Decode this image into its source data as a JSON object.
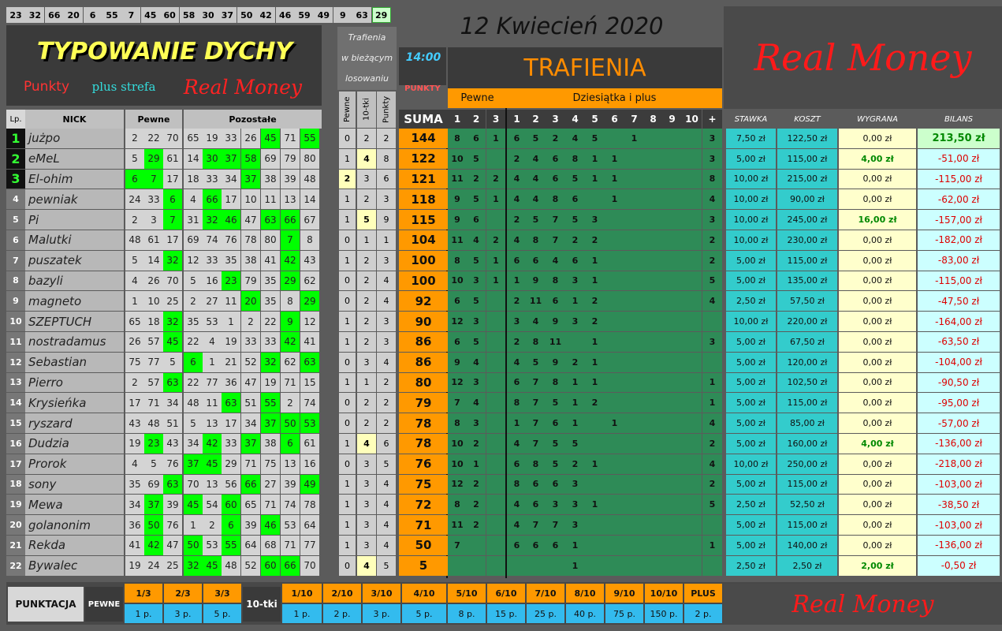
{
  "top_numbers": [
    "23",
    "32",
    "66",
    "20",
    "6",
    "55",
    "7",
    "45",
    "60",
    "58",
    "30",
    "37",
    "50",
    "42",
    "46",
    "59",
    "49",
    "9",
    "63",
    "29"
  ],
  "top_highlight_index": 19,
  "date_text": "12  Kwiecień  2020",
  "banner": {
    "title": "TYPOWANIE DYCHY",
    "sub1": "Punkty",
    "sub2": "plus strefa",
    "sub3": "Real Money"
  },
  "trafienia_box": {
    "line1": "Trafienia",
    "line2": "w bieżącym",
    "line3": "losowaniu"
  },
  "time": "14:00",
  "punkty_label": "PUNKTY",
  "trafienia_title": "TRAFIENIA",
  "pewne_label": "Pewne",
  "dziesiatka_label": "Dziesiątka i plus",
  "real_money_top": "Real Money",
  "real_money_bottom": "Real Money",
  "headers": {
    "lp": "Lp.",
    "nick": "NICK",
    "pewne": "Pewne",
    "pozostale": "Pozostałe",
    "v_pewne": "Pewne",
    "v_10tki": "10-tki",
    "v_punkty": "Punkty",
    "suma": "SUMA",
    "p_cols": [
      "1",
      "2",
      "3"
    ],
    "d_cols": [
      "1",
      "2",
      "3",
      "4",
      "5",
      "6",
      "7",
      "8",
      "9",
      "10",
      "+"
    ],
    "stawka": "STAWKA",
    "koszt": "KOSZT",
    "wygrana": "WYGRANA",
    "bilans": "BILANS"
  },
  "rows": [
    {
      "lp": "1",
      "nick": "jużpo",
      "nums": [
        "2",
        "22",
        "70",
        "65",
        "19",
        "33",
        "26",
        "45",
        "71",
        "55"
      ],
      "hits": [
        7,
        9
      ],
      "tr": [
        "0",
        "2",
        "2"
      ],
      "suma": "144",
      "p": [
        "8",
        "6",
        "1"
      ],
      "d": [
        "6",
        "5",
        "2",
        "4",
        "5",
        "",
        "1",
        "",
        "",
        "",
        ""
      ],
      "plus": "3",
      "stawka": "7,50 zł",
      "koszt": "122,50 zł",
      "wygrana": "0,00 zł",
      "bilans": "213,50 zł",
      "positive": true
    },
    {
      "lp": "2",
      "nick": "eMeL",
      "nums": [
        "5",
        "29",
        "61",
        "14",
        "30",
        "37",
        "58",
        "69",
        "79",
        "80"
      ],
      "hits": [
        1,
        4,
        5,
        6
      ],
      "tr": [
        "1",
        "4",
        "8"
      ],
      "suma": "122",
      "p": [
        "10",
        "5",
        ""
      ],
      "d": [
        "2",
        "4",
        "6",
        "8",
        "1",
        "1",
        "",
        "",
        "",
        "",
        ""
      ],
      "plus": "3",
      "stawka": "5,00 zł",
      "koszt": "115,00 zł",
      "wygrana": "4,00 zł",
      "bilans": "-51,00 zł"
    },
    {
      "lp": "3",
      "nick": "El-ohim",
      "nums": [
        "6",
        "7",
        "17",
        "18",
        "33",
        "34",
        "37",
        "38",
        "39",
        "48"
      ],
      "hits": [
        0,
        1,
        6
      ],
      "tr": [
        "2",
        "3",
        "6"
      ],
      "suma": "121",
      "p": [
        "11",
        "2",
        "2"
      ],
      "d": [
        "4",
        "4",
        "6",
        "5",
        "1",
        "1",
        "",
        "",
        "",
        "",
        ""
      ],
      "plus": "8",
      "stawka": "10,00 zł",
      "koszt": "215,00 zł",
      "wygrana": "0,00 zł",
      "bilans": "-115,00 zł"
    },
    {
      "lp": "4",
      "nick": "pewniak",
      "nums": [
        "24",
        "33",
        "6",
        "4",
        "66",
        "17",
        "10",
        "11",
        "13",
        "14"
      ],
      "hits": [
        2,
        4
      ],
      "tr": [
        "1",
        "2",
        "3"
      ],
      "suma": "118",
      "p": [
        "9",
        "5",
        "1"
      ],
      "d": [
        "4",
        "4",
        "8",
        "6",
        "",
        "1",
        "",
        "",
        "",
        "",
        ""
      ],
      "plus": "4",
      "stawka": "10,00 zł",
      "koszt": "90,00 zł",
      "wygrana": "0,00 zł",
      "bilans": "-62,00 zł"
    },
    {
      "lp": "5",
      "nick": "Pi",
      "nums": [
        "2",
        "3",
        "7",
        "31",
        "32",
        "46",
        "47",
        "63",
        "66",
        "67"
      ],
      "hits": [
        2,
        4,
        5,
        7,
        8
      ],
      "tr": [
        "1",
        "5",
        "9"
      ],
      "suma": "115",
      "p": [
        "9",
        "6",
        ""
      ],
      "d": [
        "2",
        "5",
        "7",
        "5",
        "3",
        "",
        "",
        "",
        "",
        "",
        ""
      ],
      "plus": "3",
      "stawka": "10,00 zł",
      "koszt": "245,00 zł",
      "wygrana": "16,00 zł",
      "bilans": "-157,00 zł"
    },
    {
      "lp": "6",
      "nick": "Malutki",
      "nums": [
        "48",
        "61",
        "17",
        "69",
        "74",
        "76",
        "78",
        "80",
        "7",
        "8"
      ],
      "hits": [
        8
      ],
      "tr": [
        "0",
        "1",
        "1"
      ],
      "suma": "104",
      "p": [
        "11",
        "4",
        "2"
      ],
      "d": [
        "4",
        "8",
        "7",
        "2",
        "2",
        "",
        "",
        "",
        "",
        "",
        ""
      ],
      "plus": "2",
      "stawka": "10,00 zł",
      "koszt": "230,00 zł",
      "wygrana": "0,00 zł",
      "bilans": "-182,00 zł"
    },
    {
      "lp": "7",
      "nick": "puszatek",
      "nums": [
        "5",
        "14",
        "32",
        "12",
        "33",
        "35",
        "38",
        "41",
        "42",
        "43"
      ],
      "hits": [
        2,
        8
      ],
      "tr": [
        "1",
        "2",
        "3"
      ],
      "suma": "100",
      "p": [
        "8",
        "5",
        "1"
      ],
      "d": [
        "6",
        "6",
        "4",
        "6",
        "1",
        "",
        "",
        "",
        "",
        "",
        ""
      ],
      "plus": "2",
      "stawka": "5,00 zł",
      "koszt": "115,00 zł",
      "wygrana": "0,00 zł",
      "bilans": "-83,00 zł"
    },
    {
      "lp": "8",
      "nick": "bazyli",
      "nums": [
        "4",
        "26",
        "70",
        "5",
        "16",
        "23",
        "79",
        "35",
        "29",
        "62"
      ],
      "hits": [
        5,
        8
      ],
      "tr": [
        "0",
        "2",
        "4"
      ],
      "suma": "100",
      "p": [
        "10",
        "3",
        "1"
      ],
      "d": [
        "1",
        "9",
        "8",
        "3",
        "1",
        "",
        "",
        "",
        "",
        "",
        ""
      ],
      "plus": "5",
      "stawka": "5,00 zł",
      "koszt": "135,00 zł",
      "wygrana": "0,00 zł",
      "bilans": "-115,00 zł"
    },
    {
      "lp": "9",
      "nick": "magneto",
      "nums": [
        "1",
        "10",
        "25",
        "2",
        "27",
        "11",
        "20",
        "35",
        "8",
        "29"
      ],
      "hits": [
        6,
        9
      ],
      "tr": [
        "0",
        "2",
        "4"
      ],
      "suma": "92",
      "p": [
        "6",
        "5",
        ""
      ],
      "d": [
        "2",
        "11",
        "6",
        "1",
        "2",
        "",
        "",
        "",
        "",
        "",
        ""
      ],
      "plus": "4",
      "stawka": "2,50 zł",
      "koszt": "57,50 zł",
      "wygrana": "0,00 zł",
      "bilans": "-47,50 zł"
    },
    {
      "lp": "10",
      "nick": "SZEPTUCH",
      "nums": [
        "65",
        "18",
        "32",
        "35",
        "53",
        "1",
        "2",
        "22",
        "9",
        "12"
      ],
      "hits": [
        2,
        8
      ],
      "tr": [
        "1",
        "2",
        "3"
      ],
      "suma": "90",
      "p": [
        "12",
        "3",
        ""
      ],
      "d": [
        "3",
        "4",
        "9",
        "3",
        "2",
        "",
        "",
        "",
        "",
        "",
        ""
      ],
      "plus": "",
      "stawka": "10,00 zł",
      "koszt": "220,00 zł",
      "wygrana": "0,00 zł",
      "bilans": "-164,00 zł"
    },
    {
      "lp": "11",
      "nick": "nostradamus",
      "nums": [
        "26",
        "57",
        "45",
        "22",
        "4",
        "19",
        "33",
        "33",
        "42",
        "41"
      ],
      "hits": [
        2,
        8
      ],
      "tr": [
        "1",
        "2",
        "3"
      ],
      "suma": "86",
      "p": [
        "6",
        "5",
        ""
      ],
      "d": [
        "2",
        "8",
        "11",
        "",
        "1",
        "",
        "",
        "",
        "",
        "",
        ""
      ],
      "plus": "3",
      "stawka": "5,00 zł",
      "koszt": "67,50 zł",
      "wygrana": "0,00 zł",
      "bilans": "-63,50 zł"
    },
    {
      "lp": "12",
      "nick": "Sebastian",
      "nums": [
        "75",
        "77",
        "5",
        "6",
        "1",
        "21",
        "52",
        "32",
        "62",
        "63"
      ],
      "hits": [
        3,
        7,
        9
      ],
      "tr": [
        "0",
        "3",
        "4"
      ],
      "suma": "86",
      "p": [
        "9",
        "4",
        ""
      ],
      "d": [
        "4",
        "5",
        "9",
        "2",
        "1",
        "",
        "",
        "",
        "",
        "",
        ""
      ],
      "plus": "",
      "stawka": "5,00 zł",
      "koszt": "120,00 zł",
      "wygrana": "0,00 zł",
      "bilans": "-104,00 zł"
    },
    {
      "lp": "13",
      "nick": "Pierro",
      "nums": [
        "2",
        "57",
        "63",
        "22",
        "77",
        "36",
        "47",
        "19",
        "71",
        "15"
      ],
      "hits": [
        2
      ],
      "tr": [
        "1",
        "1",
        "2"
      ],
      "suma": "80",
      "p": [
        "12",
        "3",
        ""
      ],
      "d": [
        "6",
        "7",
        "8",
        "1",
        "1",
        "",
        "",
        "",
        "",
        "",
        ""
      ],
      "plus": "1",
      "stawka": "5,00 zł",
      "koszt": "102,50 zł",
      "wygrana": "0,00 zł",
      "bilans": "-90,50 zł"
    },
    {
      "lp": "14",
      "nick": "Krysieńka",
      "nums": [
        "17",
        "71",
        "34",
        "48",
        "11",
        "63",
        "51",
        "55",
        "2",
        "74"
      ],
      "hits": [
        5,
        7
      ],
      "tr": [
        "0",
        "2",
        "2"
      ],
      "suma": "79",
      "p": [
        "7",
        "4",
        ""
      ],
      "d": [
        "8",
        "7",
        "5",
        "1",
        "2",
        "",
        "",
        "",
        "",
        "",
        ""
      ],
      "plus": "1",
      "stawka": "5,00 zł",
      "koszt": "115,00 zł",
      "wygrana": "0,00 zł",
      "bilans": "-95,00 zł"
    },
    {
      "lp": "15",
      "nick": "ryszard",
      "nums": [
        "43",
        "48",
        "51",
        "5",
        "13",
        "17",
        "34",
        "37",
        "50",
        "53"
      ],
      "hits": [
        7,
        8,
        9
      ],
      "tr": [
        "0",
        "2",
        "2"
      ],
      "suma": "78",
      "p": [
        "8",
        "3",
        ""
      ],
      "d": [
        "1",
        "7",
        "6",
        "1",
        "",
        "1",
        "",
        "",
        "",
        "",
        ""
      ],
      "plus": "4",
      "stawka": "5,00 zł",
      "koszt": "85,00 zł",
      "wygrana": "0,00 zł",
      "bilans": "-57,00 zł"
    },
    {
      "lp": "16",
      "nick": "Dudzia",
      "nums": [
        "19",
        "23",
        "43",
        "34",
        "42",
        "33",
        "37",
        "38",
        "6",
        "61"
      ],
      "hits": [
        1,
        4,
        6,
        8
      ],
      "tr": [
        "1",
        "4",
        "6"
      ],
      "suma": "78",
      "p": [
        "10",
        "2",
        ""
      ],
      "d": [
        "4",
        "7",
        "5",
        "5",
        "",
        "",
        "",
        "",
        "",
        "",
        ""
      ],
      "plus": "2",
      "stawka": "5,00 zł",
      "koszt": "160,00 zł",
      "wygrana": "4,00 zł",
      "bilans": "-136,00 zł"
    },
    {
      "lp": "17",
      "nick": "Prorok",
      "nums": [
        "4",
        "5",
        "76",
        "37",
        "45",
        "29",
        "71",
        "75",
        "13",
        "16"
      ],
      "hits": [
        3,
        4
      ],
      "tr": [
        "0",
        "3",
        "5"
      ],
      "suma": "76",
      "p": [
        "10",
        "1",
        ""
      ],
      "d": [
        "6",
        "8",
        "5",
        "2",
        "1",
        "",
        "",
        "",
        "",
        "",
        ""
      ],
      "plus": "4",
      "stawka": "10,00 zł",
      "koszt": "250,00 zł",
      "wygrana": "0,00 zł",
      "bilans": "-218,00 zł"
    },
    {
      "lp": "18",
      "nick": "sony",
      "nums": [
        "35",
        "69",
        "63",
        "70",
        "13",
        "56",
        "66",
        "27",
        "39",
        "49"
      ],
      "hits": [
        2,
        6,
        9
      ],
      "tr": [
        "1",
        "3",
        "4"
      ],
      "suma": "75",
      "p": [
        "12",
        "2",
        ""
      ],
      "d": [
        "8",
        "6",
        "6",
        "3",
        "",
        "",
        "",
        "",
        "",
        "",
        ""
      ],
      "plus": "2",
      "stawka": "5,00 zł",
      "koszt": "115,00 zł",
      "wygrana": "0,00 zł",
      "bilans": "-103,00 zł"
    },
    {
      "lp": "19",
      "nick": "Mewa",
      "nums": [
        "34",
        "37",
        "39",
        "45",
        "54",
        "60",
        "65",
        "71",
        "74",
        "78"
      ],
      "hits": [
        1,
        3,
        5
      ],
      "tr": [
        "1",
        "3",
        "4"
      ],
      "suma": "72",
      "p": [
        "8",
        "2",
        ""
      ],
      "d": [
        "4",
        "6",
        "3",
        "3",
        "1",
        "",
        "",
        "",
        "",
        "",
        ""
      ],
      "plus": "5",
      "stawka": "2,50 zł",
      "koszt": "52,50 zł",
      "wygrana": "0,00 zł",
      "bilans": "-38,50 zł"
    },
    {
      "lp": "20",
      "nick": "golanonim",
      "nums": [
        "36",
        "50",
        "76",
        "1",
        "2",
        "6",
        "39",
        "46",
        "53",
        "64"
      ],
      "hits": [
        1,
        5,
        7
      ],
      "tr": [
        "1",
        "3",
        "4"
      ],
      "suma": "71",
      "p": [
        "11",
        "2",
        ""
      ],
      "d": [
        "4",
        "7",
        "7",
        "3",
        "",
        "",
        "",
        "",
        "",
        "",
        ""
      ],
      "plus": "",
      "stawka": "5,00 zł",
      "koszt": "115,00 zł",
      "wygrana": "0,00 zł",
      "bilans": "-103,00 zł"
    },
    {
      "lp": "21",
      "nick": "Rekda",
      "nums": [
        "41",
        "42",
        "47",
        "50",
        "53",
        "55",
        "64",
        "68",
        "71",
        "77"
      ],
      "hits": [
        1,
        3,
        5
      ],
      "tr": [
        "1",
        "3",
        "4"
      ],
      "suma": "50",
      "p": [
        "7",
        "",
        ""
      ],
      "d": [
        "6",
        "6",
        "6",
        "1",
        "",
        "",
        "",
        "",
        "",
        "",
        ""
      ],
      "plus": "1",
      "stawka": "5,00 zł",
      "koszt": "140,00 zł",
      "wygrana": "0,00 zł",
      "bilans": "-136,00 zł"
    },
    {
      "lp": "22",
      "nick": "Bywalec",
      "nums": [
        "19",
        "24",
        "25",
        "32",
        "45",
        "48",
        "52",
        "60",
        "66",
        "70"
      ],
      "hits": [
        3,
        4,
        7,
        8
      ],
      "tr": [
        "0",
        "4",
        "5"
      ],
      "suma": "5",
      "p": [
        "",
        "",
        ""
      ],
      "d": [
        "",
        "",
        "",
        "1",
        "",
        "",
        "",
        "",
        "",
        "",
        ""
      ],
      "plus": "",
      "stawka": "2,50 zł",
      "koszt": "2,50 zł",
      "wygrana": "2,00 zł",
      "bilans": "-0,50 zł"
    }
  ],
  "bottom": {
    "punktacja": "PUNKTACJA",
    "pewne": "PEWNE",
    "tens": "10-tki",
    "p_heads": [
      "1/3",
      "2/3",
      "3/3"
    ],
    "p_vals": [
      "1 p.",
      "3 p.",
      "5 p."
    ],
    "d_heads": [
      "1/10",
      "2/10",
      "3/10",
      "4/10",
      "5/10",
      "6/10",
      "7/10",
      "8/10",
      "9/10",
      "10/10",
      "PLUS"
    ],
    "d_vals": [
      "1 p.",
      "2 p.",
      "3 p.",
      "5 p.",
      "8 p.",
      "15 p.",
      "25 p.",
      "40 p.",
      "75 p.",
      "150 p.",
      "2 p."
    ]
  },
  "colors": {
    "bg": "#5b5b5b",
    "green": "#00ff00",
    "orange": "#ff9900",
    "dark_green": "#2e8b57",
    "cyan": "#33cccc",
    "light_cyan": "#ccffff",
    "light_yellow": "#ffffcc",
    "gray": "#c0c0c0"
  }
}
